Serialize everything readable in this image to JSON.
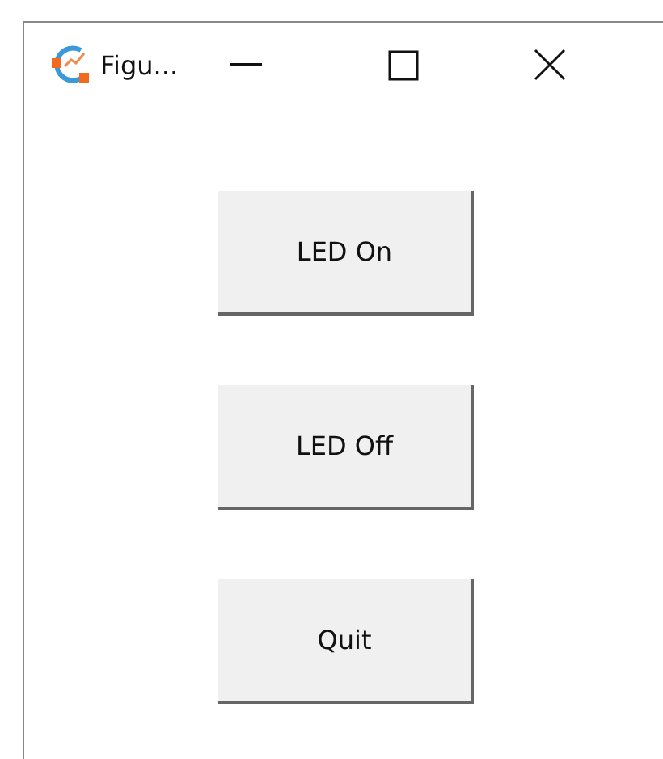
{
  "window": {
    "title": "Figu..."
  },
  "buttons": [
    {
      "label": "LED On"
    },
    {
      "label": "LED Off"
    },
    {
      "label": "Quit"
    }
  ]
}
